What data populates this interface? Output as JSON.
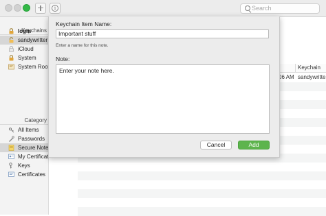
{
  "toolbar": {
    "search_placeholder": "Search",
    "colors": {
      "zoom": "#33b847",
      "close_inactive": "#d1d1d1"
    }
  },
  "sidebar": {
    "keychains_header": "Keychains",
    "keychains": [
      {
        "label": "login",
        "icon": "lock-icon",
        "selected": false
      },
      {
        "label": "sandywritter",
        "icon": "unlocked-lock-icon",
        "selected": true
      },
      {
        "label": "iCloud",
        "icon": "cloud-lock-icon",
        "selected": false
      },
      {
        "label": "System",
        "icon": "lock-icon",
        "selected": false
      },
      {
        "label": "System Roots",
        "icon": "certificate-lock-icon",
        "selected": false
      }
    ],
    "category_header": "Category",
    "categories": [
      {
        "label": "All Items",
        "icon": "all-items-icon",
        "selected": false
      },
      {
        "label": "Passwords",
        "icon": "key-pen-icon",
        "selected": false
      },
      {
        "label": "Secure Notes",
        "icon": "note-icon",
        "selected": true
      },
      {
        "label": "My Certificates",
        "icon": "my-certificate-icon",
        "selected": false
      },
      {
        "label": "Keys",
        "icon": "key-icon",
        "selected": false
      },
      {
        "label": "Certificates",
        "icon": "certificate-icon",
        "selected": false
      }
    ]
  },
  "table": {
    "column_keychain": "Keychain",
    "row1_time": "06 AM",
    "row1_keychain": "sandywritter"
  },
  "dialog": {
    "name_label": "Keychain Item Name:",
    "name_value": "Important stuff",
    "name_hint": "Enter a name for this note.",
    "note_label": "Note:",
    "note_placeholder": "Enter your note here.",
    "cancel_label": "Cancel",
    "add_label": "Add",
    "colors": {
      "add_button": "#5db44d"
    }
  }
}
